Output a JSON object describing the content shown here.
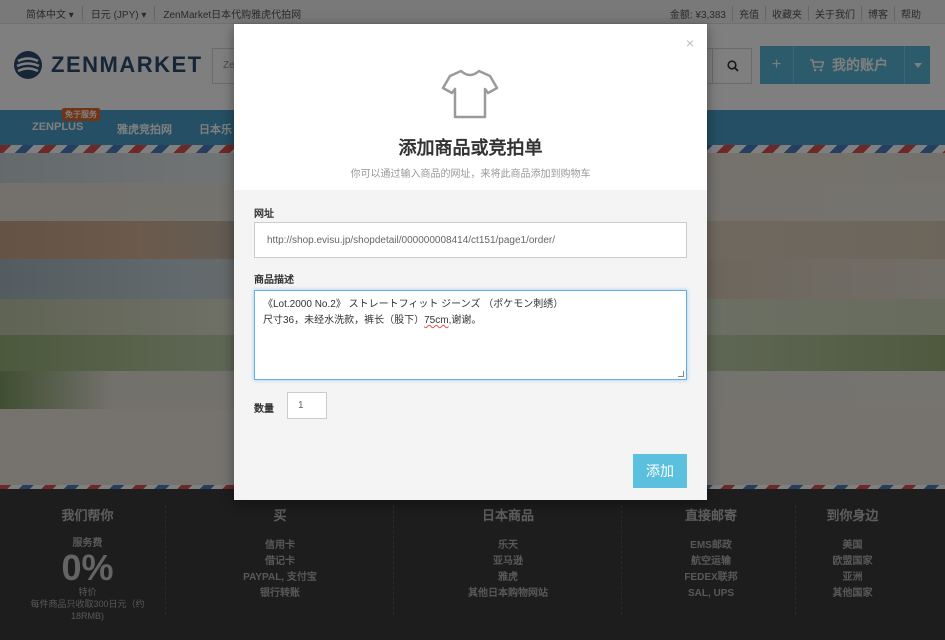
{
  "topbar": {
    "left": [
      "简体中文 ▾",
      "日元 (JPY) ▾",
      "ZenMarket日本代购雅虎代拍网"
    ],
    "right": [
      "金额: ¥3,383",
      "充值",
      "收藏夹",
      "关于我们",
      "博客",
      "帮助"
    ]
  },
  "header": {
    "logo_text": "ZENMARKET",
    "search_placeholder": "Ze",
    "account_plus": "+",
    "account_label": "我的账户"
  },
  "nav": {
    "badge": "免于服务",
    "items": [
      "ZENPLUS",
      "雅虎竞拍网",
      "日本乐"
    ]
  },
  "modal": {
    "close": "×",
    "title": "添加商品或竞拍单",
    "subtitle": "你可以通过输入商品的网址，来将此商品添加到购物车",
    "url_label": "网址",
    "url_value": "http://shop.evisu.jp/shopdetail/000000008414/ct151/page1/order/",
    "desc_label": "商品描述",
    "desc_line1": "《Lot.2000 No.2》 ストレートフィット ジーンズ （ポケモン刺绣）",
    "desc_line2_a": "尺寸36，未经水洗款，裤长（股下）",
    "desc_line2_b": "75cm",
    "desc_line2_c": ",谢谢。",
    "qty_label": "数量",
    "qty_value": "1",
    "add_button": "添加"
  },
  "footer": {
    "col1": {
      "head": "我们帮你",
      "fee_label": "服务费",
      "zero": "0%",
      "special": "特价",
      "note1": "每件商品只收取300日元（约",
      "note2": "18RMB)"
    },
    "col2": {
      "head": "买",
      "items": [
        "信用卡",
        "借记卡",
        "PAYPAL, 支付宝",
        "银行转账"
      ]
    },
    "col3": {
      "head": "日本商品",
      "items": [
        "乐天",
        "亚马逊",
        "雅虎",
        "其他日本购物网站"
      ]
    },
    "col4": {
      "head": "直接邮寄",
      "items": [
        "EMS邮政",
        "航空运输",
        "FEDEX联邦",
        "SAL, UPS"
      ]
    },
    "col5": {
      "head": "到你身边",
      "items": [
        "美国",
        "欧盟国家",
        "亚洲",
        "其他国家"
      ]
    }
  },
  "colors": {
    "accent": "#5bc0de",
    "nav": "#4a9fc8",
    "logo": "#2d4a70",
    "footer": "#3a3a3a"
  }
}
